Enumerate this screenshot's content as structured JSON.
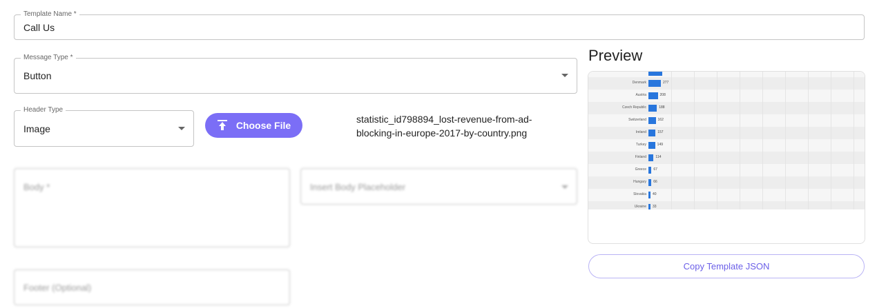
{
  "template_name": {
    "label": "Template Name *",
    "value": "Call Us"
  },
  "message_type": {
    "label": "Message Type *",
    "value": "Button"
  },
  "header_type": {
    "label": "Header Type",
    "value": "Image"
  },
  "choose_file": {
    "label": "Choose File",
    "icon": "upload-icon"
  },
  "file_name": "statistic_id798894_lost-revenue-from-ad-blocking-in-europe-2017-by-country.png",
  "body": {
    "placeholder": "Body *"
  },
  "body_placeholder_select": {
    "placeholder": "Insert Body Placeholder"
  },
  "footer": {
    "placeholder": "Footer (Optional)"
  },
  "preview": {
    "title": "Preview",
    "image_rows": [
      {
        "label": "Denmark",
        "value": 277
      },
      {
        "label": "Austria",
        "value": 208
      },
      {
        "label": "Czech Republic",
        "value": 188
      },
      {
        "label": "Switzerland",
        "value": 162
      },
      {
        "label": "Ireland",
        "value": 157
      },
      {
        "label": "Turkey",
        "value": 149
      },
      {
        "label": "Finland",
        "value": 114
      },
      {
        "label": "Greece",
        "value": 67
      },
      {
        "label": "Hungary",
        "value": 66
      },
      {
        "label": "Slovakia",
        "value": 40
      },
      {
        "label": "Ukraine",
        "value": 33
      }
    ]
  },
  "copy_button": {
    "label": "Copy Template JSON"
  },
  "colors": {
    "accent": "#7b6ef6",
    "bar": "#2876dd"
  }
}
